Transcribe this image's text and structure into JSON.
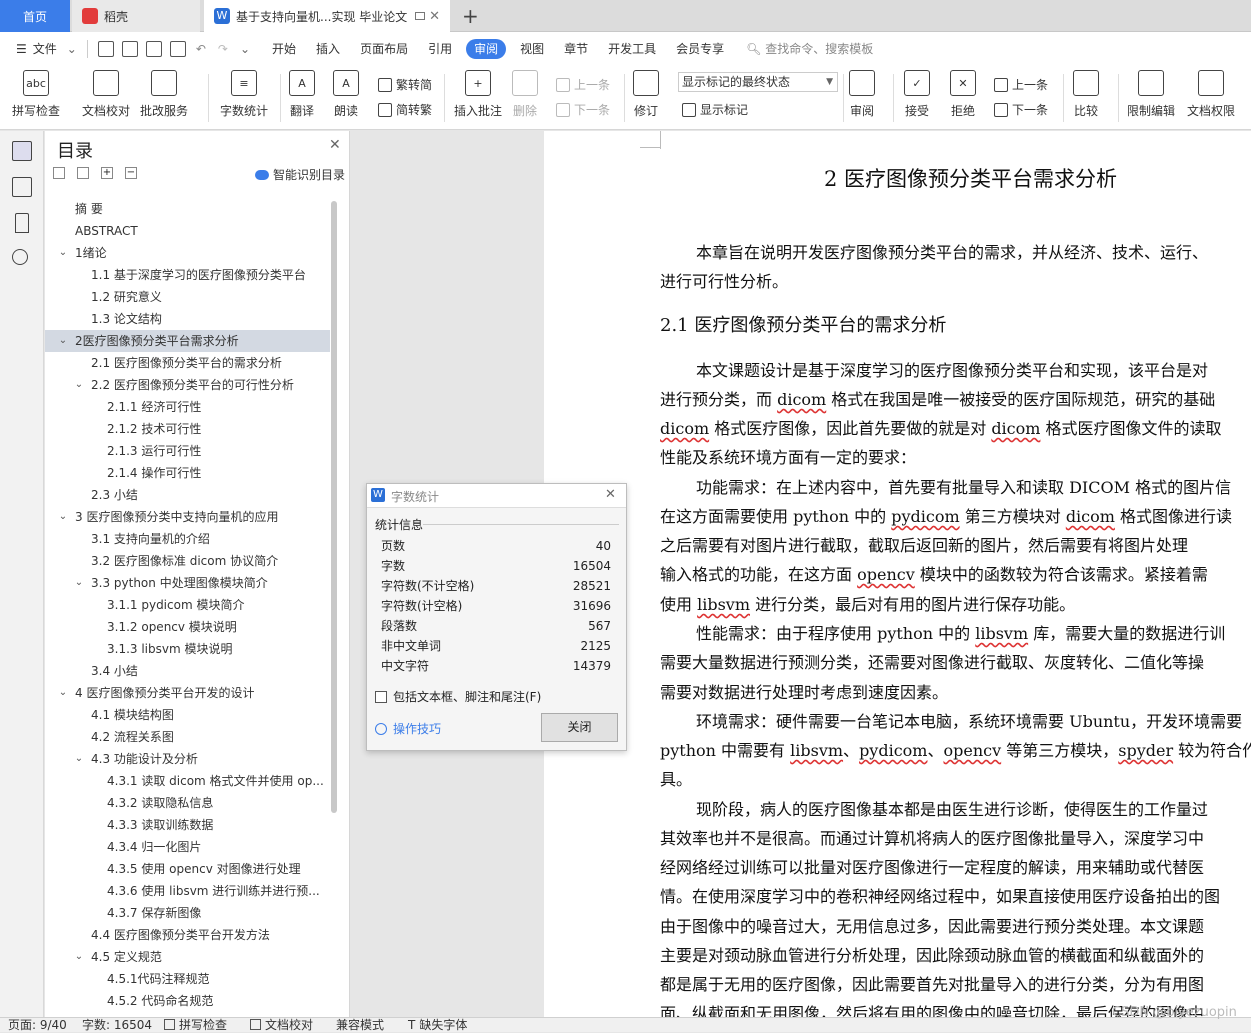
{
  "tabs": [
    {
      "label": "首页"
    },
    {
      "label": "稻壳"
    },
    {
      "label": "基于支持向量机...实现 毕业论文"
    }
  ],
  "new_tab_label": "+",
  "menu": {
    "file_label": "文件",
    "items": [
      "开始",
      "插入",
      "页面布局",
      "引用",
      "审阅",
      "视图",
      "章节",
      "开发工具",
      "会员专享"
    ],
    "active_item": "审阅",
    "search_placeholder": "查找命令、搜索模板"
  },
  "toolbar": {
    "spell_check": "拼写检查",
    "doc_check": "文档校对",
    "batch_service": "批改服务",
    "word_count": "字数统计",
    "translate": "翻译",
    "read_aloud": "朗读",
    "trad": "繁转简",
    "simp": "简转繁",
    "insert_comment": "插入批注",
    "delete": "删除",
    "prev": "上一条",
    "next": "下一条",
    "revise": "修订",
    "markup_state": "显示标记的最终状态",
    "show_markup": "显示标记",
    "review": "审阅",
    "accept": "接受",
    "reject": "拒绝",
    "prev2": "上一条",
    "next2": "下一条",
    "compare": "比较",
    "restrict_edit": "限制编辑",
    "doc_permission": "文档权限"
  },
  "toc": {
    "title": "目录",
    "smart_label": "智能识别目录",
    "items": [
      {
        "text": "摘  要",
        "level": 0,
        "chev": ""
      },
      {
        "text": "ABSTRACT",
        "level": 0,
        "chev": ""
      },
      {
        "text": "1绪论",
        "level": 0,
        "chev": "v"
      },
      {
        "text": "1.1  基于深度学习的医疗图像预分类平台",
        "level": 1,
        "chev": ""
      },
      {
        "text": "1.2  研究意义",
        "level": 1,
        "chev": ""
      },
      {
        "text": "1.3  论文结构",
        "level": 1,
        "chev": ""
      },
      {
        "text": "2医疗图像预分类平台需求分析",
        "level": 0,
        "chev": "v",
        "selected": true
      },
      {
        "text": "2.1  医疗图像预分类平台的需求分析",
        "level": 1,
        "chev": ""
      },
      {
        "text": "2.2  医疗图像预分类平台的可行性分析",
        "level": 1,
        "chev": "v"
      },
      {
        "text": "2.1.1  经济可行性",
        "level": 2,
        "chev": ""
      },
      {
        "text": "2.1.2  技术可行性",
        "level": 2,
        "chev": ""
      },
      {
        "text": "2.1.3  运行可行性",
        "level": 2,
        "chev": ""
      },
      {
        "text": "2.1.4  操作可行性",
        "level": 2,
        "chev": ""
      },
      {
        "text": "2.3  小结",
        "level": 1,
        "chev": ""
      },
      {
        "text": "3  医疗图像预分类中支持向量机的应用",
        "level": 0,
        "chev": "v"
      },
      {
        "text": "3.1  支持向量机的介绍",
        "level": 1,
        "chev": ""
      },
      {
        "text": "3.2  医疗图像标准 dicom 协议简介",
        "level": 1,
        "chev": ""
      },
      {
        "text": "3.3 python 中处理图像模块简介",
        "level": 1,
        "chev": "v"
      },
      {
        "text": "3.1.1 pydicom 模块简介",
        "level": 2,
        "chev": ""
      },
      {
        "text": "3.1.2 opencv 模块说明",
        "level": 2,
        "chev": ""
      },
      {
        "text": "3.1.3 libsvm 模块说明",
        "level": 2,
        "chev": ""
      },
      {
        "text": "3.4  小结",
        "level": 1,
        "chev": ""
      },
      {
        "text": "4  医疗图像预分类平台开发的设计",
        "level": 0,
        "chev": "v"
      },
      {
        "text": "4.1  模块结构图",
        "level": 1,
        "chev": ""
      },
      {
        "text": "4.2  流程关系图",
        "level": 1,
        "chev": ""
      },
      {
        "text": "4.3  功能设计及分析",
        "level": 1,
        "chev": "v"
      },
      {
        "text": "4.3.1  读取 dicom 格式文件并使用 op...",
        "level": 2,
        "chev": ""
      },
      {
        "text": "4.3.2  读取隐私信息",
        "level": 2,
        "chev": ""
      },
      {
        "text": "4.3.3  读取训练数据",
        "level": 2,
        "chev": ""
      },
      {
        "text": "4.3.4  归一化图片",
        "level": 2,
        "chev": ""
      },
      {
        "text": "4.3.5  使用 opencv 对图像进行处理",
        "level": 2,
        "chev": ""
      },
      {
        "text": "4.3.6  使用 libsvm 进行训练并进行预...",
        "level": 2,
        "chev": ""
      },
      {
        "text": "4.3.7  保存新图像",
        "level": 2,
        "chev": ""
      },
      {
        "text": "4.4  医疗图像预分类平台开发方法",
        "level": 1,
        "chev": ""
      },
      {
        "text": "4.5  定义规范",
        "level": 1,
        "chev": "v"
      },
      {
        "text": "4.5.1代码注释规范",
        "level": 2,
        "chev": ""
      },
      {
        "text": "4.5.2  代码命名规范",
        "level": 2,
        "chev": ""
      }
    ]
  },
  "document": {
    "chapter_title": "2   医疗图像预分类平台需求分析",
    "section_title": "2.1  医疗图像预分类平台的需求分析",
    "lines": [
      {
        "t": "本章旨在说明开发医疗图像预分类平台的需求，并从经济、技术、运行、",
        "indent": true
      },
      {
        "t": "进行可行性分析。",
        "indent": false
      },
      {
        "t": "本文课题设计是基于深度学习的医疗图像预分类平台和实现，该平台是对",
        "indent": true
      },
      {
        "t": "进行预分类，而 dicom 格式在我国是唯一被接受的医疗国际规范，研究的基础",
        "indent": false
      },
      {
        "t": "dicom 格式医疗图像，因此首先要做的就是对 dicom 格式医疗图像文件的读取",
        "indent": false
      },
      {
        "t": "性能及系统环境方面有一定的要求：",
        "indent": false
      },
      {
        "t": "功能需求：在上述内容中，首先要有批量导入和读取 DICOM 格式的图片信",
        "indent": true
      },
      {
        "t": "在这方面需要使用 python 中的 pydicom 第三方模块对 dicom 格式图像进行读",
        "indent": false
      },
      {
        "t": "之后需要有对图片进行截取，截取后返回新的图片，然后需要有将图片处理",
        "indent": false
      },
      {
        "t": "输入格式的功能，在这方面 opencv 模块中的函数较为符合该需求。紧接着需",
        "indent": false
      },
      {
        "t": "使用 libsvm 进行分类，最后对有用的图片进行保存功能。",
        "indent": false
      },
      {
        "t": "性能需求：由于程序使用 python 中的 libsvm 库，需要大量的数据进行训",
        "indent": true
      },
      {
        "t": "需要大量数据进行预测分类，还需要对图像进行截取、灰度转化、二值化等操",
        "indent": false
      },
      {
        "t": "需要对数据进行处理时考虑到速度因素。",
        "indent": false
      },
      {
        "t": "环境需求：硬件需要一台笔记本电脑，系统环境需要 Ubuntu，开发环境需要",
        "indent": true
      },
      {
        "t": "python 中需要有 libsvm、pydicom、opencv 等第三方模块，spyder 较为符合作",
        "indent": false
      },
      {
        "t": "具。",
        "indent": false
      },
      {
        "t": "现阶段，病人的医疗图像基本都是由医生进行诊断，使得医生的工作量过",
        "indent": true
      },
      {
        "t": "其效率也并不是很高。而通过计算机将病人的医疗图像批量导入，深度学习中",
        "indent": false
      },
      {
        "t": "经网络经过训练可以批量对医疗图像进行一定程度的解读，用来辅助或代替医",
        "indent": false
      },
      {
        "t": "情。在使用深度学习中的卷积神经网络过程中，如果直接使用医疗设备拍出的图",
        "indent": false
      },
      {
        "t": "由于图像中的噪音过大，无用信息过多，因此需要进行预分类处理。本文课题",
        "indent": false
      },
      {
        "t": "主要是对颈动脉血管进行分析处理，因此除颈动脉血管的横截面和纵截面外的",
        "indent": false
      },
      {
        "t": "都是属于无用的医疗图像，因此需要首先对批量导入的进行分类，分为有用图",
        "indent": false
      },
      {
        "t": "面、纵截面和无用图像，然后将有用的图像中的噪音切除，最后保存的图像中",
        "indent": false
      }
    ]
  },
  "dialog": {
    "title": "字数统计",
    "section": "统计信息",
    "stats": [
      {
        "label": "页数",
        "value": "40"
      },
      {
        "label": "字数",
        "value": "16504"
      },
      {
        "label": "字符数(不计空格)",
        "value": "28521"
      },
      {
        "label": "字符数(计空格)",
        "value": "31696"
      },
      {
        "label": "段落数",
        "value": "567"
      },
      {
        "label": "非中文单词",
        "value": "2125"
      },
      {
        "label": "中文字符",
        "value": "14379"
      }
    ],
    "checkbox_label": "包括文本框、脚注和尾注(F)",
    "tips_label": "操作技巧",
    "close_label": "关闭"
  },
  "status": {
    "page": "页面: 9/40",
    "words": "字数: 16504",
    "spell": "拼写检查",
    "proof": "文档校对",
    "compat": "兼容模式",
    "missing_font": "缺失字体"
  },
  "watermark": "CSDN @biyezuopin",
  "colors": {
    "accent": "#3b7de9",
    "wps_red": "#e23c3c",
    "selected_bg": "#d3d9e2"
  }
}
